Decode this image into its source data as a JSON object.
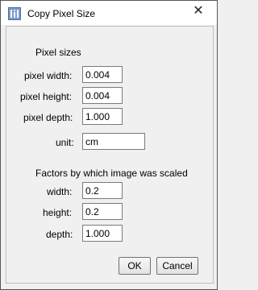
{
  "window": {
    "title": "Copy Pixel Size",
    "close_glyph": "✕"
  },
  "pixel_sizes": {
    "heading": "Pixel sizes",
    "width_label": "pixel width:",
    "width_value": "0.004",
    "height_label": "pixel height:",
    "height_value": "0.004",
    "depth_label": "pixel depth:",
    "depth_value": "1.000",
    "unit_label": "unit:",
    "unit_value": "cm"
  },
  "scale": {
    "heading": "Factors by which image was scaled",
    "width_label": "width:",
    "width_value": "0.2",
    "height_label": "height:",
    "height_value": "0.2",
    "depth_label": "depth:",
    "depth_value": "1.000"
  },
  "buttons": {
    "ok": "OK",
    "cancel": "Cancel"
  },
  "icons": {
    "title": "imagej-window-icon",
    "close": "close-icon"
  }
}
